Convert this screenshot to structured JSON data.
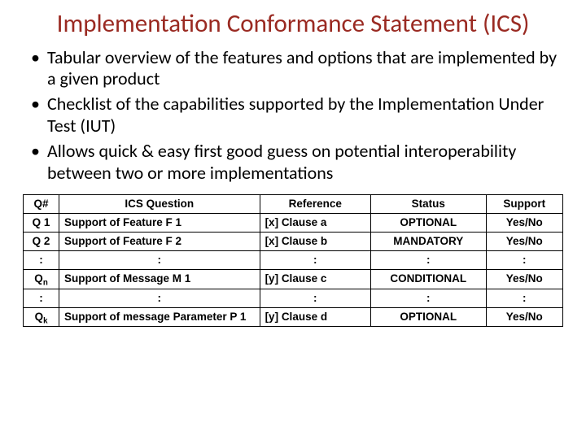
{
  "title": "Implementation Conformance Statement (ICS)",
  "bullets": [
    "Tabular overview of the features and options that are implemented by a given product",
    "Checklist of the capabilities supported by the Implementation Under Test (IUT)",
    "Allows quick & easy first good guess on potential interoperability between two or more implementations"
  ],
  "table": {
    "headers": {
      "q": "Q#",
      "ics": "ICS Question",
      "ref": "Reference",
      "status": "Status",
      "support": "Support"
    },
    "rows": [
      {
        "q": "Q 1",
        "ics": "Support of Feature F 1",
        "ref": "[x] Clause a",
        "status": "OPTIONAL",
        "support": "Yes/No",
        "ellipsis": false,
        "qsub": ""
      },
      {
        "q": "Q 2",
        "ics": "Support of Feature F 2",
        "ref": "[x] Clause b",
        "status": "MANDATORY",
        "support": "Yes/No",
        "ellipsis": false,
        "qsub": ""
      },
      {
        "q": ":",
        "ics": ":",
        "ref": ":",
        "status": ":",
        "support": ":",
        "ellipsis": true,
        "qsub": ""
      },
      {
        "q": "Q",
        "ics": "Support of Message M 1",
        "ref": "[y] Clause c",
        "status": "CONDITIONAL",
        "support": "Yes/No",
        "ellipsis": false,
        "qsub": "n"
      },
      {
        "q": ":",
        "ics": ":",
        "ref": ":",
        "status": ":",
        "support": ":",
        "ellipsis": true,
        "qsub": ""
      },
      {
        "q": "Q",
        "ics": "Support of message Parameter P 1",
        "ref": "[y] Clause d",
        "status": "OPTIONAL",
        "support": "Yes/No",
        "ellipsis": false,
        "qsub": "k"
      }
    ]
  },
  "chart_data": {
    "type": "table",
    "title": "Implementation Conformance Statement (ICS)",
    "columns": [
      "Q#",
      "ICS Question",
      "Reference",
      "Status",
      "Support"
    ],
    "rows": [
      [
        "Q 1",
        "Support of Feature F 1",
        "[x] Clause a",
        "OPTIONAL",
        "Yes/No"
      ],
      [
        "Q 2",
        "Support of Feature F 2",
        "[x] Clause b",
        "MANDATORY",
        "Yes/No"
      ],
      [
        ":",
        ":",
        ":",
        ":",
        ":"
      ],
      [
        "Qn",
        "Support of Message M 1",
        "[y] Clause c",
        "CONDITIONAL",
        "Yes/No"
      ],
      [
        ":",
        ":",
        ":",
        ":",
        ":"
      ],
      [
        "Qk",
        "Support of message Parameter P 1",
        "[y] Clause d",
        "OPTIONAL",
        "Yes/No"
      ]
    ]
  }
}
